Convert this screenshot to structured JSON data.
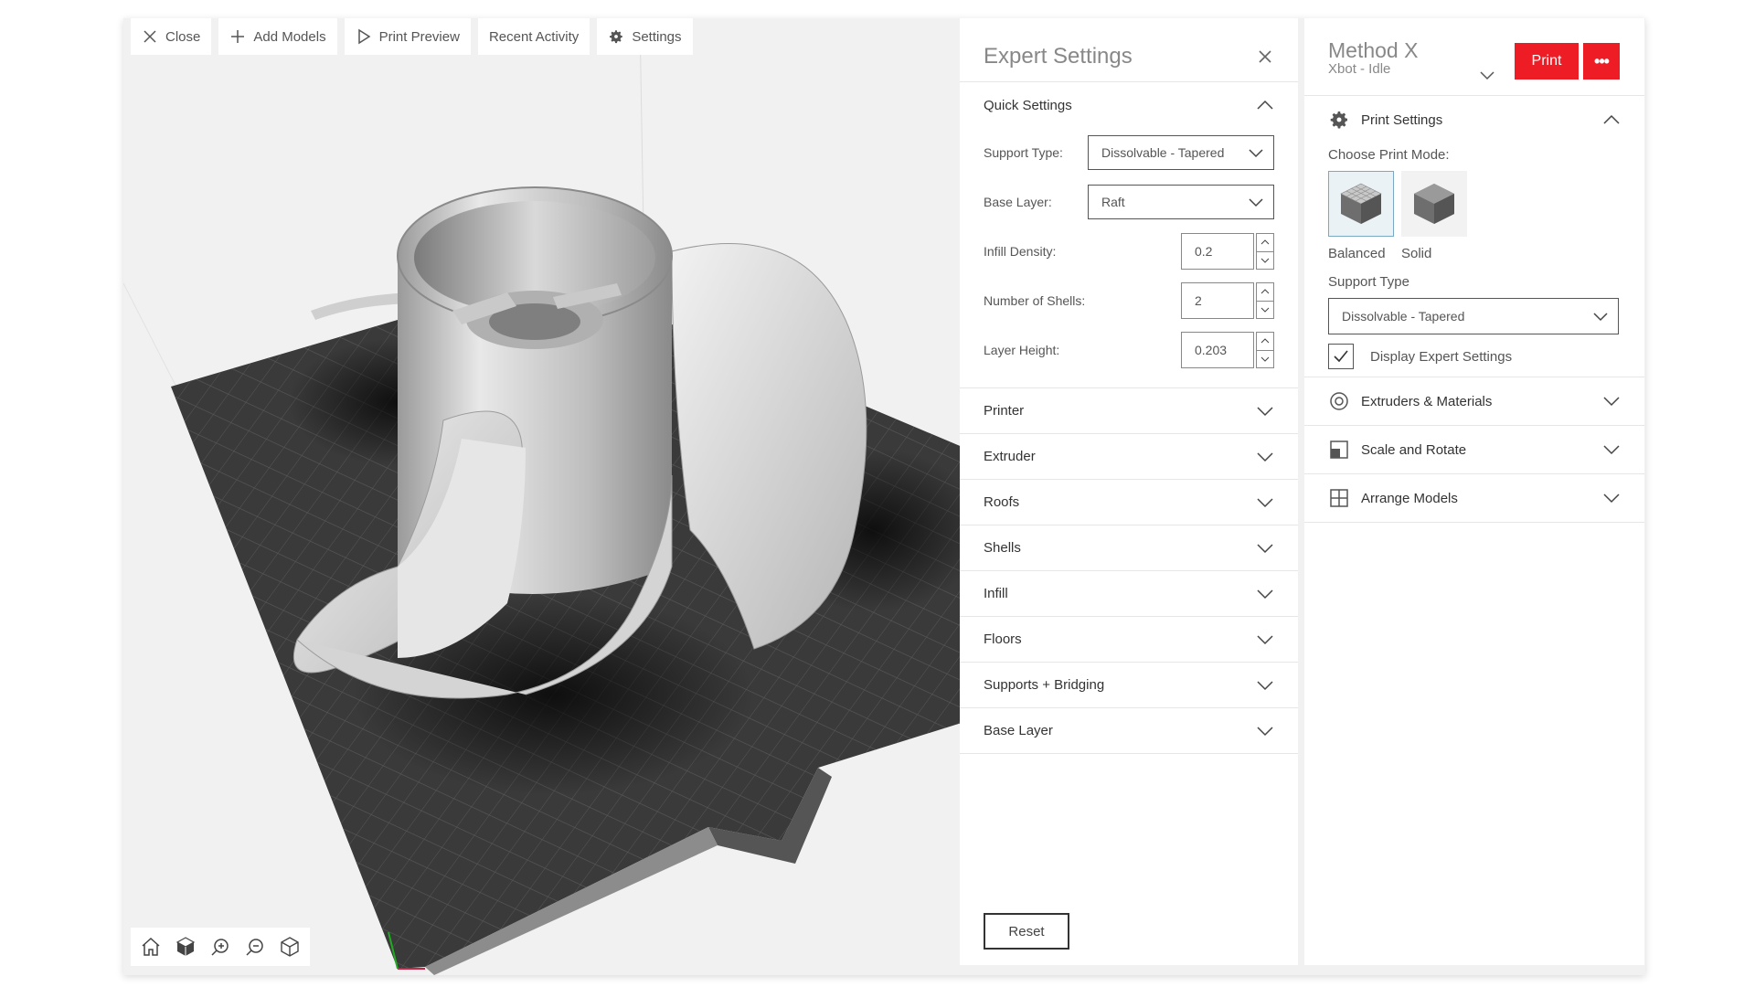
{
  "toolbar": {
    "close": "Close",
    "add_models": "Add Models",
    "print_preview": "Print Preview",
    "recent_activity": "Recent Activity",
    "settings": "Settings"
  },
  "expert": {
    "title": "Expert Settings",
    "quick": {
      "title": "Quick Settings",
      "support_type_label": "Support Type:",
      "support_type_value": "Dissolvable - Tapered",
      "base_layer_label": "Base Layer:",
      "base_layer_value": "Raft",
      "infill_density_label": "Infill Density:",
      "infill_density_value": "0.2",
      "shells_label": "Number of Shells:",
      "shells_value": "2",
      "layer_height_label": "Layer Height:",
      "layer_height_value": "0.203"
    },
    "sections": [
      "Printer",
      "Extruder",
      "Roofs",
      "Shells",
      "Infill",
      "Floors",
      "Supports + Bridging",
      "Base Layer"
    ],
    "reset": "Reset"
  },
  "printer": {
    "name": "Method X",
    "status": "Xbot - Idle",
    "print": "Print",
    "more": "•••",
    "print_settings": "Print Settings",
    "choose_mode": "Choose Print Mode:",
    "modes": [
      "Balanced",
      "Solid"
    ],
    "support_type_label": "Support Type",
    "support_type_value": "Dissolvable - Tapered",
    "display_expert": "Display Expert Settings",
    "extruders": "Extruders & Materials",
    "scale_rotate": "Scale and Rotate",
    "arrange": "Arrange Models"
  },
  "colors": {
    "accent": "#ee1c25",
    "build_plate": "#3a3a3a",
    "model": "#d0d0d0"
  }
}
